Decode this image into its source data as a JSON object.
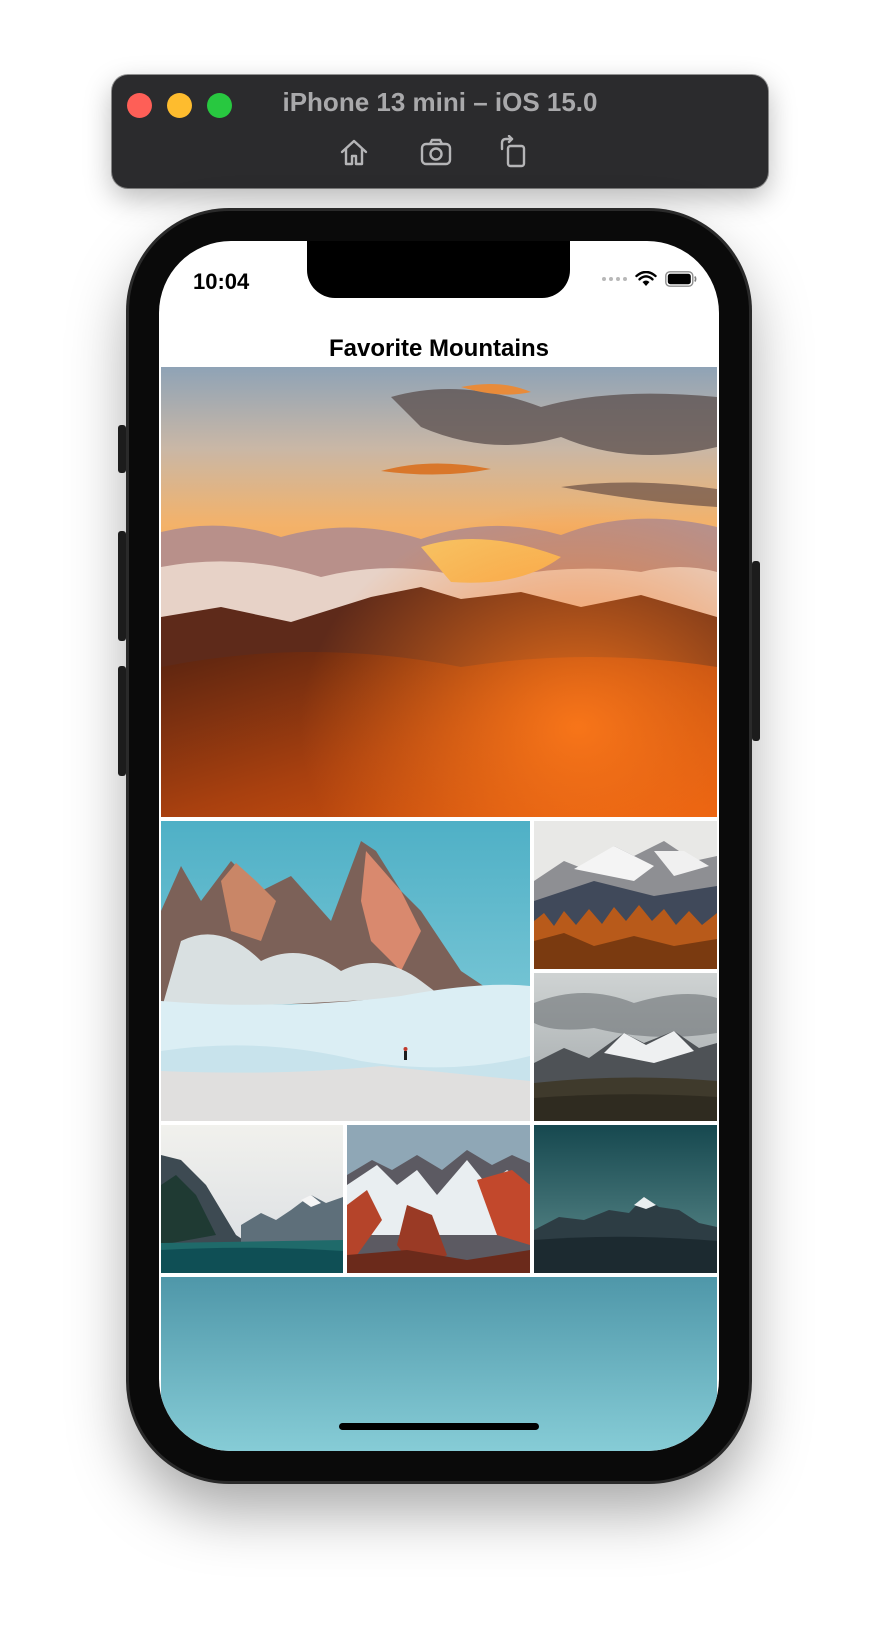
{
  "simulator": {
    "title": "iPhone 13 mini – iOS 15.0",
    "tools": [
      "home-icon",
      "screenshot-icon",
      "rotate-icon"
    ]
  },
  "status_bar": {
    "time": "10:04",
    "icons": [
      "signal-dots-icon",
      "wifi-icon",
      "battery-icon"
    ]
  },
  "nav": {
    "title": "Favorite Mountains"
  },
  "gallery": {
    "photos": [
      "sunset-mountains-photo",
      "snowy-dolomites-photo",
      "autumn-forest-mountains-photo",
      "cloudy-snow-peaks-photo",
      "alpine-lake-photo",
      "red-rock-snow-peaks-photo",
      "dusk-peak-photo",
      "blue-sky-photo"
    ]
  },
  "colors": {
    "sim_bar": "#2b2b2d",
    "traffic_red": "#fe5f57",
    "traffic_yellow": "#febc2e",
    "traffic_green": "#28c840"
  }
}
